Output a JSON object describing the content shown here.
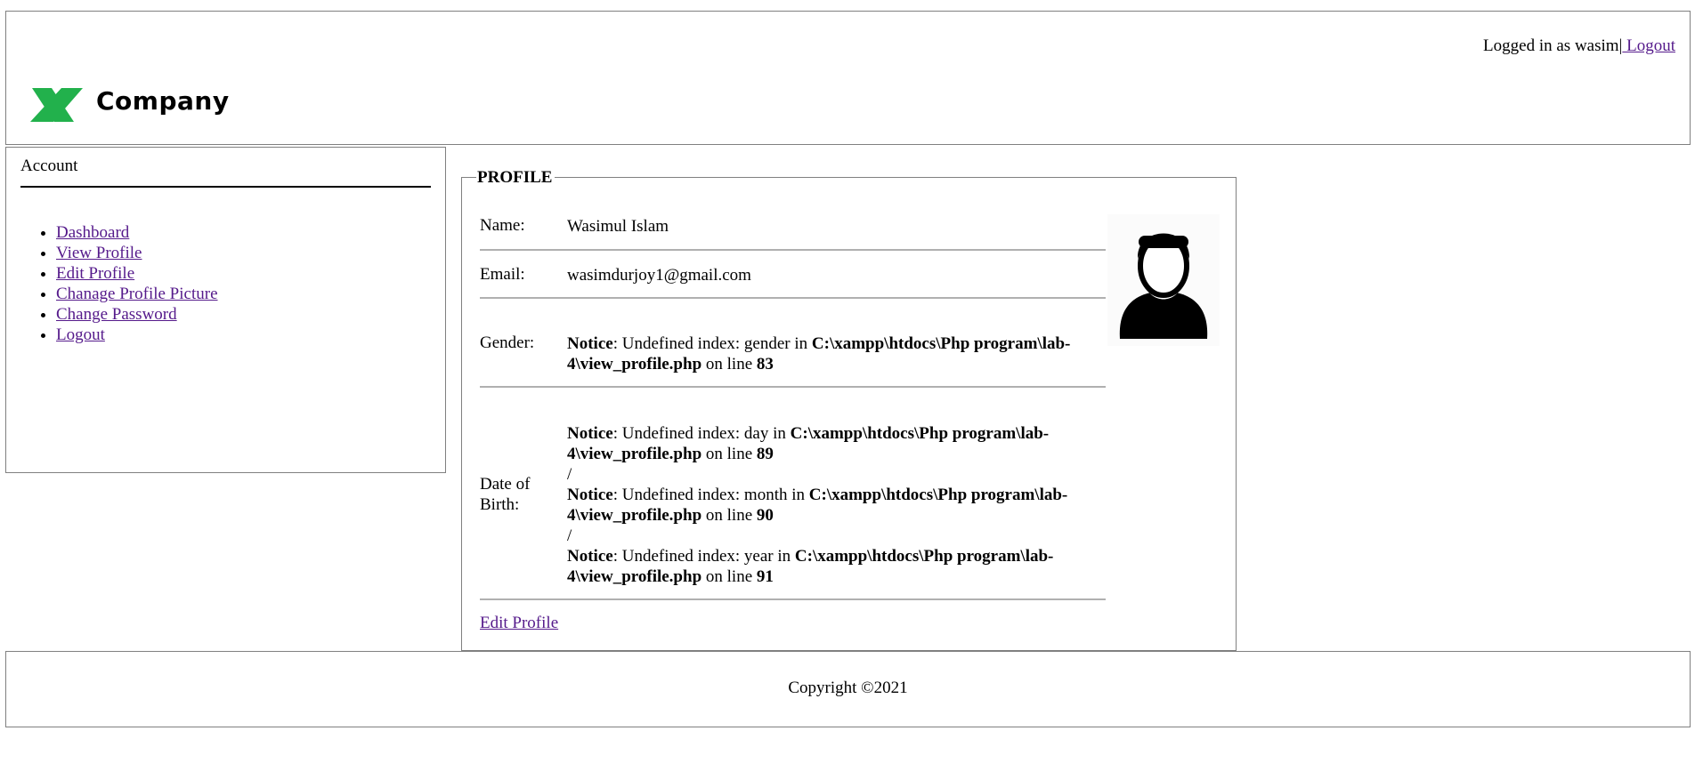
{
  "header": {
    "login_prefix": "Logged in as wasim|",
    "logout_label": " Logout",
    "logo_text": "Company",
    "logo_color": "#22b14c"
  },
  "sidebar": {
    "title": "Account",
    "items": [
      {
        "label": "Dashboard"
      },
      {
        "label": "View Profile"
      },
      {
        "label": "Edit Profile"
      },
      {
        "label": "Chanage Profile Picture"
      },
      {
        "label": "Change Password"
      },
      {
        "label": "Logout"
      }
    ]
  },
  "profile": {
    "legend": "PROFILE",
    "name_label": "Name:",
    "name_value": "Wasimul Islam",
    "email_label": "Email:",
    "email_value": "wasimdurjoy1@gmail.com",
    "gender_label": "Gender:",
    "dob_label": "Date of Birth:",
    "gender_notice": {
      "notice": "Notice",
      "msg": ": Undefined index: gender in ",
      "path": "C:\\xampp\\htdocs\\Php program\\lab-4\\view_profile.php",
      "online": " on line ",
      "line": "83"
    },
    "day_notice": {
      "notice": "Notice",
      "msg": ": Undefined index: day in ",
      "path": "C:\\xampp\\htdocs\\Php program\\lab-4\\view_profile.php",
      "online": " on line ",
      "line": "89"
    },
    "month_notice": {
      "notice": "Notice",
      "msg": ": Undefined index: month in ",
      "path": "C:\\xampp\\htdocs\\Php program\\lab-4\\view_profile.php",
      "online": " on line ",
      "line": "90"
    },
    "year_notice": {
      "notice": "Notice",
      "msg": ": Undefined index: year in ",
      "path": "C:\\xampp\\htdocs\\Php program\\lab-4\\view_profile.php",
      "online": " on line ",
      "line": "91"
    },
    "separator": "/",
    "edit_link": "Edit Profile",
    "avatar_icon": "user-avatar-icon"
  },
  "footer": {
    "copyright": "Copyright ©2021"
  }
}
